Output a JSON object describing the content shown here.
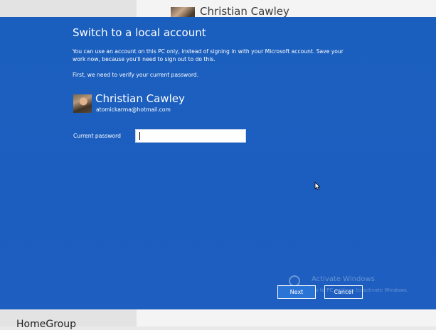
{
  "background": {
    "user_name": "Christian Cawley",
    "homegroup_label": "HomeGroup"
  },
  "dialog": {
    "title": "Switch to a local account",
    "description": "You can use an account on this PC only, instead of signing in with your Microsoft account. Save your work now, because you'll need to sign out to do this.",
    "verify_text": "First, we need to verify your current password.",
    "user": {
      "name": "Christian Cawley",
      "email": "atomickarma@hotmail.com"
    },
    "password": {
      "label": "Current password",
      "value": ""
    },
    "buttons": {
      "next": "Next",
      "cancel": "Cancel"
    }
  },
  "watermark": {
    "title": "Activate Windows",
    "subtitle": "Go to PC settings to activate Windows."
  },
  "colors": {
    "dialog_bg": "#1d5ec0",
    "next_button": "#2a74d6",
    "text": "#ffffff"
  }
}
